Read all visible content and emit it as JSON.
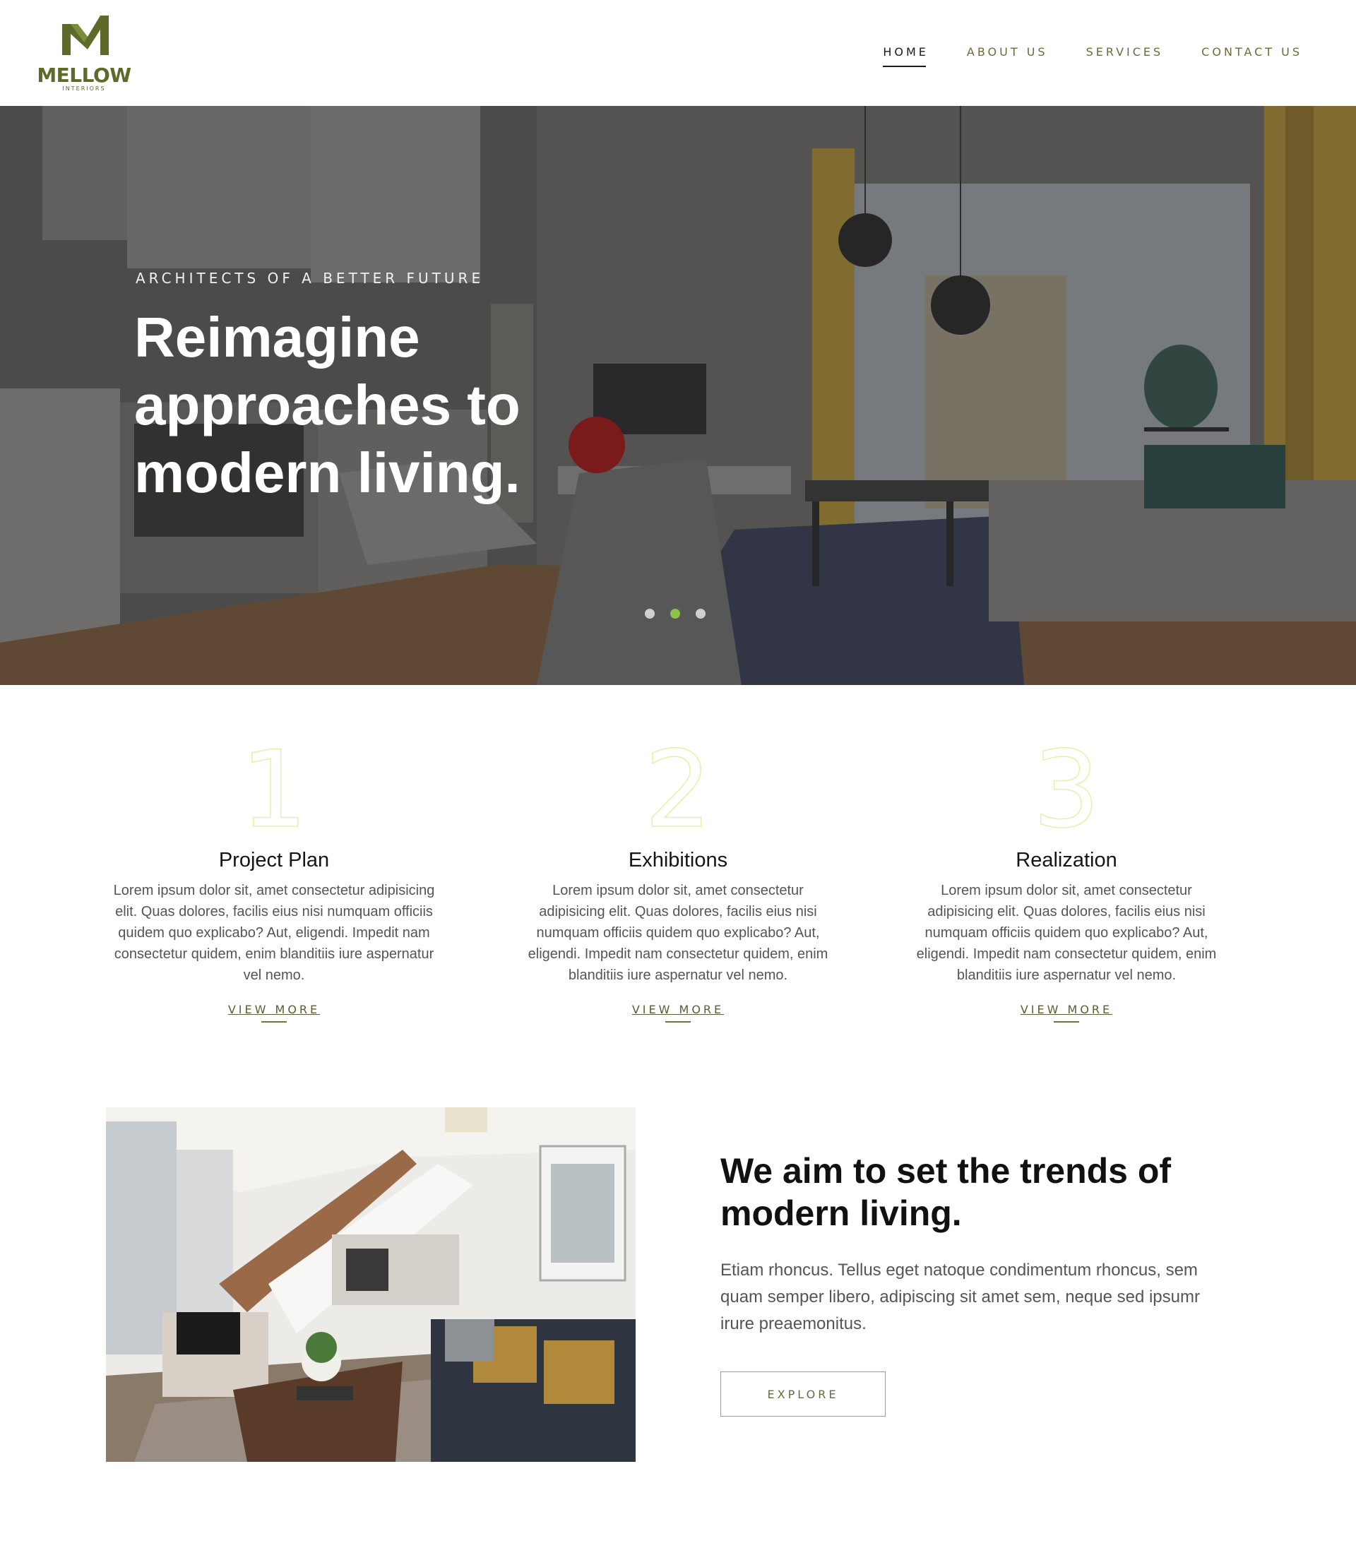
{
  "brand": {
    "name": "MELLOW",
    "tagline": "INTERIORS",
    "accent_color": "#5c6b2a"
  },
  "nav": {
    "items": [
      {
        "label": "HOME",
        "active": true
      },
      {
        "label": "ABOUT US",
        "active": false
      },
      {
        "label": "SERVICES",
        "active": false
      },
      {
        "label": "CONTACT US",
        "active": false
      }
    ]
  },
  "hero": {
    "eyebrow": "ARCHITECTS OF A BETTER FUTURE",
    "title": "Reimagine approaches to modern living.",
    "slides_total": 3,
    "active_slide": 2,
    "active_dot_color": "#8cc14a"
  },
  "features": [
    {
      "number": "1",
      "title": "Project Plan",
      "text": "Lorem ipsum dolor sit, amet consectetur adipisicing elit. Quas dolores, facilis eius nisi numquam officiis quidem quo explicabo? Aut, eligendi. Impedit nam consectetur quidem, enim blanditiis iure aspernatur vel nemo.",
      "link": "VIEW MORE"
    },
    {
      "number": "2",
      "title": "Exhibitions",
      "text": "Lorem ipsum dolor sit, amet consectetur adipisicing elit. Quas dolores, facilis eius nisi numquam officiis quidem quo explicabo? Aut, eligendi. Impedit nam consectetur quidem, enim blanditiis iure aspernatur vel nemo.",
      "link": "VIEW MORE"
    },
    {
      "number": "3",
      "title": "Realization",
      "text": "Lorem ipsum dolor sit, amet consectetur adipisicing elit. Quas dolores, facilis eius nisi numquam officiis quidem quo explicabo? Aut, eligendi. Impedit nam consectetur quidem, enim blanditiis iure aspernatur vel nemo.",
      "link": "VIEW MORE"
    }
  ],
  "about": {
    "title": "We aim to set the trends of modern living.",
    "text": "Etiam rhoncus. Tellus eget natoque condimentum rhoncus, sem quam semper libero, adipiscing sit amet sem, neque sed ipsumr irure preaemonitus.",
    "button": "EXPLORE"
  }
}
